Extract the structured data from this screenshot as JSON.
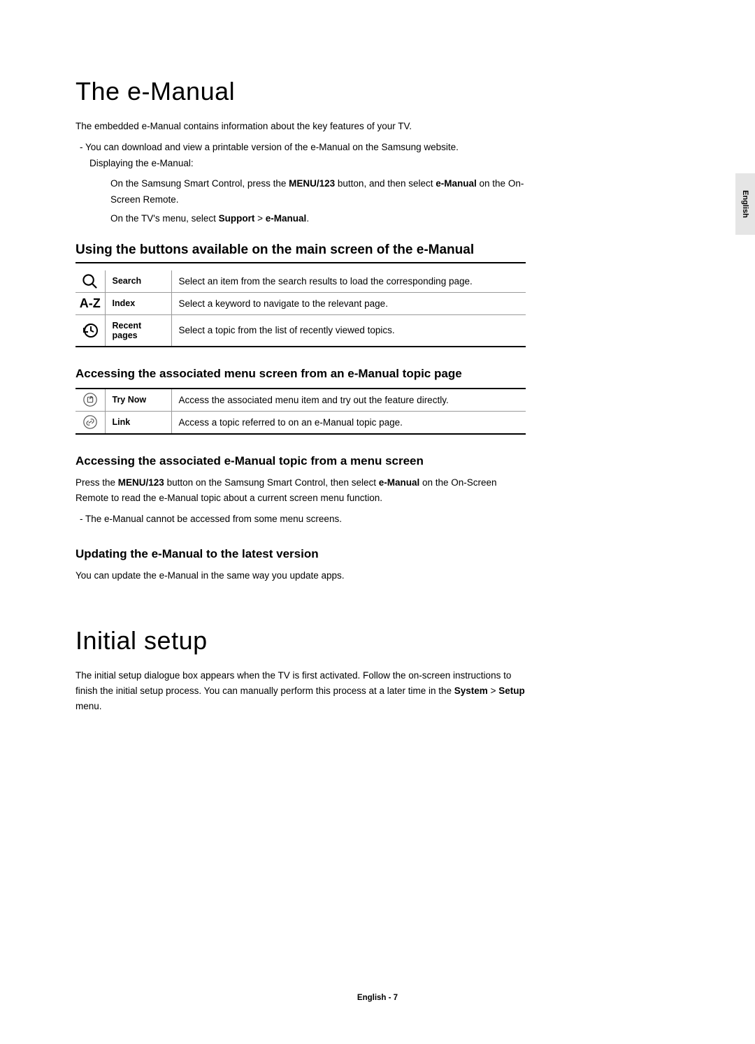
{
  "sideTab": "English",
  "footer": "English - 7",
  "section1": {
    "title": "The e-Manual",
    "intro": "The embedded e-Manual contains information about the key features of your TV.",
    "bullet1": "You can download and view a printable version of the e-Manual on the Samsung website.",
    "displayLine": "Displaying the e-Manual:",
    "deep1a": "On the Samsung Smart Control, press the ",
    "deep1b": "MENU/123",
    "deep1c": " button, and then select ",
    "deep1d": "e-Manual",
    "deep1e": " on the On-Screen Remote.",
    "deep2a": "On the TV's menu, select ",
    "deep2b": "Support",
    "deep2c": " > ",
    "deep2d": "e-Manual",
    "deep2e": ".",
    "h2a": "Using the buttons available on the main screen of the e-Manual",
    "table1": [
      {
        "label": "Search",
        "desc": "Select an item from the search results to load the corresponding page."
      },
      {
        "label": "Index",
        "desc": "Select a keyword to navigate to the relevant page."
      },
      {
        "label": "Recent pages",
        "desc": "Select a topic from the list of recently viewed topics."
      }
    ],
    "h3a": "Accessing the associated menu screen from an e-Manual topic page",
    "table2": [
      {
        "label": "Try Now",
        "desc": "Access the associated menu item and try out the feature directly."
      },
      {
        "label": "Link",
        "desc": "Access a topic referred to on an e-Manual topic page."
      }
    ],
    "h3b": "Accessing the associated e-Manual topic from a menu screen",
    "p3b_a": "Press the ",
    "p3b_b": "MENU/123",
    "p3b_c": " button on the Samsung Smart Control, then select ",
    "p3b_d": "e-Manual",
    "p3b_e": " on the On-Screen Remote to read the e-Manual topic about a current screen menu function.",
    "bullet3b": "The e-Manual cannot be accessed from some menu screens.",
    "h3c": "Updating the e-Manual to the latest version",
    "p3c": "You can update the e-Manual in the same way you update apps."
  },
  "section2": {
    "title": "Initial setup",
    "p_a": "The initial setup dialogue box appears when the TV is first activated. Follow the on-screen instructions to finish the initial setup process. You can manually perform this process at a later time in the ",
    "p_b": "System",
    "p_c": " > ",
    "p_d": "Setup",
    "p_e": " menu."
  },
  "icons": {
    "az": "A-Z"
  }
}
